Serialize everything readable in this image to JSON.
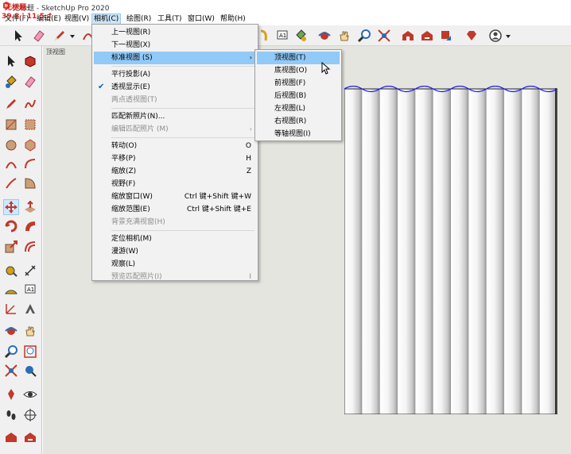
{
  "titlebar": {
    "title": "无标题 - SketchUp Pro 2020",
    "watermark_top": "无标题-",
    "watermark_bottom": "39.8 | 11.5 ↑"
  },
  "menubar": {
    "items": [
      {
        "label": "文件(F)"
      },
      {
        "label": "编辑(E)"
      },
      {
        "label": "视图(V)"
      },
      {
        "label": "相机(C)"
      },
      {
        "label": "绘图(R)"
      },
      {
        "label": "工具(T)"
      },
      {
        "label": "窗口(W)"
      },
      {
        "label": "帮助(H)"
      }
    ]
  },
  "viewport": {
    "scene_label": "顶视图"
  },
  "camera_menu": {
    "items": [
      {
        "label": "上一视图(R)",
        "shortcut": ""
      },
      {
        "label": "下一视图(X)",
        "shortcut": ""
      },
      {
        "label": "标准视图 (S)",
        "shortcut": ""
      },
      {
        "label": "平行投影(A)",
        "shortcut": ""
      },
      {
        "label": "透视显示(E)",
        "shortcut": ""
      },
      {
        "label": "两点透视图(T)",
        "shortcut": ""
      },
      {
        "label": "匹配新照片(N)...",
        "shortcut": ""
      },
      {
        "label": "编辑匹配照片 (M)",
        "shortcut": ""
      },
      {
        "label": "转动(O)",
        "shortcut": "O"
      },
      {
        "label": "平移(P)",
        "shortcut": "H"
      },
      {
        "label": "缩放(Z)",
        "shortcut": "Z"
      },
      {
        "label": "视野(F)",
        "shortcut": ""
      },
      {
        "label": "缩放窗口(W)",
        "shortcut": "Ctrl 键+Shift 键+W"
      },
      {
        "label": "缩放范围(E)",
        "shortcut": "Ctrl 键+Shift 键+E"
      },
      {
        "label": "背景充满视窗(H)",
        "shortcut": ""
      },
      {
        "label": "定位相机(M)",
        "shortcut": ""
      },
      {
        "label": "漫游(W)",
        "shortcut": ""
      },
      {
        "label": "观察(L)",
        "shortcut": ""
      },
      {
        "label": "预览匹配照片(I)",
        "shortcut": "I"
      }
    ]
  },
  "standard_views_menu": {
    "items": [
      {
        "label": "顶视图(T)"
      },
      {
        "label": "底视图(O)"
      },
      {
        "label": "前视图(F)"
      },
      {
        "label": "后视图(B)"
      },
      {
        "label": "左视图(L)"
      },
      {
        "label": "右视图(R)"
      },
      {
        "label": "等轴视图(I)"
      }
    ]
  },
  "colors": {
    "menu_highlight": "#91c9f7",
    "viewport_bg": "#e5e5df",
    "blue_edge": "#1a1aff"
  }
}
